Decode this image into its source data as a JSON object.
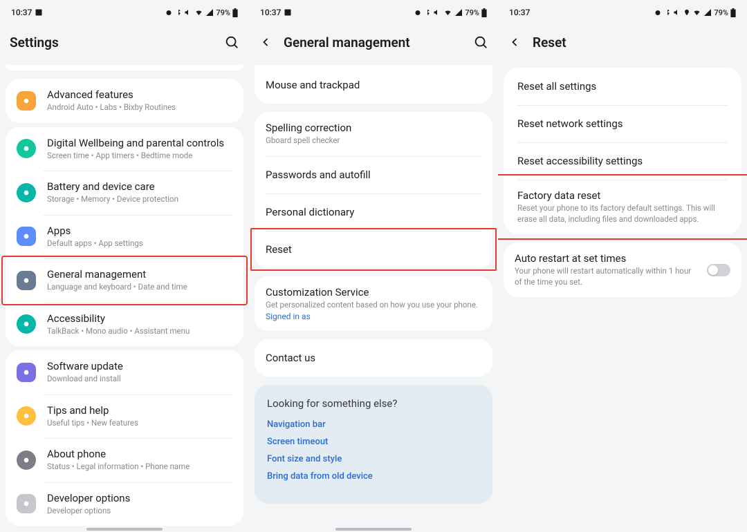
{
  "status": {
    "time": "10:37",
    "battery": "79%"
  },
  "screenA": {
    "title": "Settings",
    "groups": [
      {
        "items": [
          {
            "icon": "advanced-icon",
            "iconClass": "c-orange",
            "title": "Advanced features",
            "sub": "Android Auto  •  Labs  •  Bixby Routines"
          }
        ]
      },
      {
        "items": [
          {
            "icon": "wellbeing-icon",
            "iconClass": "c-green",
            "title": "Digital Wellbeing and parental controls",
            "sub": "Screen time  •  App timers  •  Bedtime mode"
          },
          {
            "icon": "battery-icon",
            "iconClass": "c-teal",
            "title": "Battery and device care",
            "sub": "Storage  •  Memory  •  Device protection"
          },
          {
            "icon": "apps-icon",
            "iconClass": "c-blue",
            "title": "Apps",
            "sub": "Default apps  •  App settings"
          },
          {
            "icon": "general-icon",
            "iconClass": "c-slate",
            "title": "General management",
            "sub": "Language and keyboard  •  Date and time",
            "highlight": true
          },
          {
            "icon": "accessibility-icon",
            "iconClass": "c-teal",
            "title": "Accessibility",
            "sub": "TalkBack  •  Mono audio  •  Assistant menu"
          }
        ]
      },
      {
        "items": [
          {
            "icon": "update-icon",
            "iconClass": "c-purple",
            "title": "Software update",
            "sub": "Download and install"
          },
          {
            "icon": "tips-icon",
            "iconClass": "c-yellow",
            "title": "Tips and help",
            "sub": "Useful tips  •  New features"
          },
          {
            "icon": "about-icon",
            "iconClass": "c-gray",
            "title": "About phone",
            "sub": "Status  •  Legal information  •  Phone name"
          },
          {
            "icon": "devopts-icon",
            "iconClass": "c-lgray",
            "title": "Developer options",
            "sub": "Developer options"
          }
        ]
      }
    ]
  },
  "screenB": {
    "title": "General management",
    "top_items": [
      {
        "title": "Mouse and trackpad"
      }
    ],
    "mid_items": [
      {
        "title": "Spelling correction",
        "sub": "Gboard spell checker"
      },
      {
        "title": "Passwords and autofill"
      },
      {
        "title": "Personal dictionary"
      },
      {
        "title": "Reset",
        "highlight": true
      }
    ],
    "customization": {
      "title": "Customization Service",
      "sub": "Get personalized content based on how you use your phone.",
      "link": "Signed in as"
    },
    "contact": {
      "title": "Contact us"
    },
    "panel": {
      "title": "Looking for something else?",
      "links": [
        "Navigation bar",
        "Screen timeout",
        "Font size and style",
        "Bring data from old device"
      ]
    }
  },
  "screenC": {
    "title": "Reset",
    "items": [
      {
        "title": "Reset all settings"
      },
      {
        "title": "Reset network settings"
      },
      {
        "title": "Reset accessibility settings"
      },
      {
        "title": "Factory data reset",
        "sub": "Reset your phone to its factory default settings. This will erase all data, including files and downloaded apps.",
        "highlight": true
      }
    ],
    "auto": {
      "title": "Auto restart at set times",
      "sub": "Your phone will restart automatically within 1 hour of the time you set."
    }
  }
}
